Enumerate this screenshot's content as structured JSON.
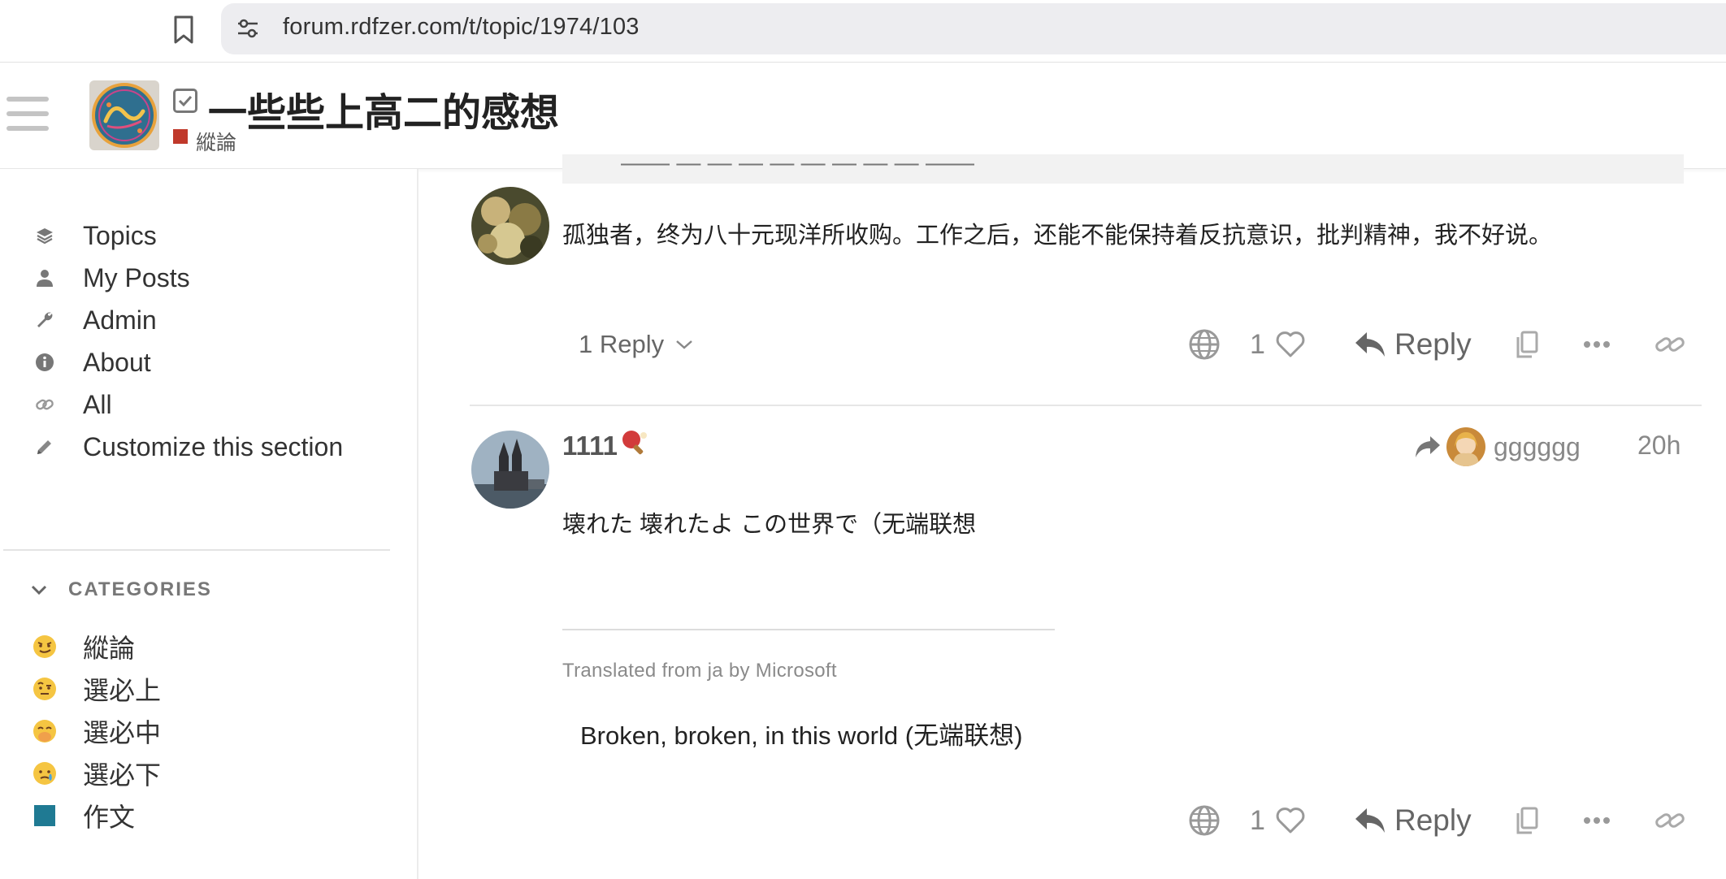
{
  "browser": {
    "url": "forum.rdfzer.com/t/topic/1974/103"
  },
  "header": {
    "topic_title": "一些些上高二的感想",
    "category": "縱論",
    "category_color": "#c0392b"
  },
  "sidebar": {
    "items": [
      {
        "label": "Topics",
        "icon": "layers-icon"
      },
      {
        "label": "My Posts",
        "icon": "user-icon"
      },
      {
        "label": "Admin",
        "icon": "wrench-icon"
      },
      {
        "label": "About",
        "icon": "info-icon"
      },
      {
        "label": "All",
        "icon": "link-icon"
      },
      {
        "label": "Customize this section",
        "icon": "pencil-icon"
      }
    ],
    "categories_header": "CATEGORIES",
    "categories": [
      {
        "label": "縱論",
        "icon": "smirk-emoji-icon"
      },
      {
        "label": "選必上",
        "icon": "raised-eyebrow-emoji-icon"
      },
      {
        "label": "選必中",
        "icon": "hand-over-mouth-emoji-icon"
      },
      {
        "label": "選必下",
        "icon": "tearful-emoji-icon"
      },
      {
        "label": "作文",
        "icon": "teal-square-icon"
      }
    ]
  },
  "posts": [
    {
      "text": "孤独者，终为八十元现洋所收购。工作之后，还能不能保持着反抗意识，批判精神，我不好说。",
      "replies_label": "1 Reply",
      "likes": "1",
      "reply_label": "Reply"
    },
    {
      "username": "1111",
      "user_flair": "ping-pong-icon",
      "reply_to_user": "gggggg",
      "time": "20h",
      "text": "壊れた 壊れたよ この世界で（无端联想",
      "translation_note": "Translated from ja by Microsoft",
      "translated_text": "Broken, broken, in this world (无端联想)",
      "likes": "1",
      "reply_label": "Reply"
    }
  ]
}
